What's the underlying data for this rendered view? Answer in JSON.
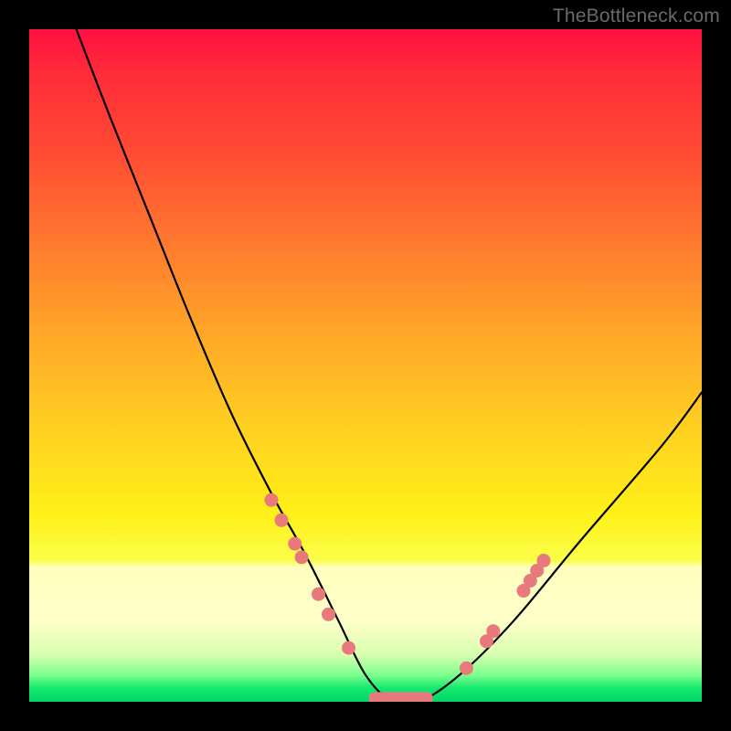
{
  "watermark": "TheBottleneck.com",
  "chart_data": {
    "type": "line",
    "title": "",
    "xlabel": "",
    "ylabel": "",
    "xlim": [
      0,
      100
    ],
    "ylim": [
      0,
      100
    ],
    "grid": false,
    "legend": false,
    "series": [
      {
        "name": "bottleneck-curve",
        "x": [
          7,
          12,
          18,
          24,
          30,
          36,
          41,
          46,
          50,
          54,
          58,
          64,
          72,
          82,
          94,
          100
        ],
        "values": [
          100,
          87,
          72,
          57,
          43,
          31,
          22,
          12,
          4,
          0,
          0,
          4,
          12,
          24,
          38,
          46
        ]
      }
    ],
    "markers_left": [
      {
        "x": 36.0,
        "y": 30.0
      },
      {
        "x": 37.5,
        "y": 27.0
      },
      {
        "x": 39.5,
        "y": 23.5
      },
      {
        "x": 40.5,
        "y": 21.5
      },
      {
        "x": 43.0,
        "y": 16.0
      },
      {
        "x": 44.5,
        "y": 13.0
      },
      {
        "x": 47.5,
        "y": 8.0
      }
    ],
    "markers_right": [
      {
        "x": 65.0,
        "y": 5.0
      },
      {
        "x": 68.0,
        "y": 9.0
      },
      {
        "x": 69.0,
        "y": 10.5
      },
      {
        "x": 73.5,
        "y": 16.5
      },
      {
        "x": 74.5,
        "y": 18.0
      },
      {
        "x": 75.5,
        "y": 19.5
      },
      {
        "x": 76.5,
        "y": 21.0
      }
    ],
    "flat_band": {
      "x0": 50.5,
      "x1": 60.0,
      "y": 0.5
    },
    "marker_color": "#e87a7e",
    "curve_color": "#000000"
  }
}
